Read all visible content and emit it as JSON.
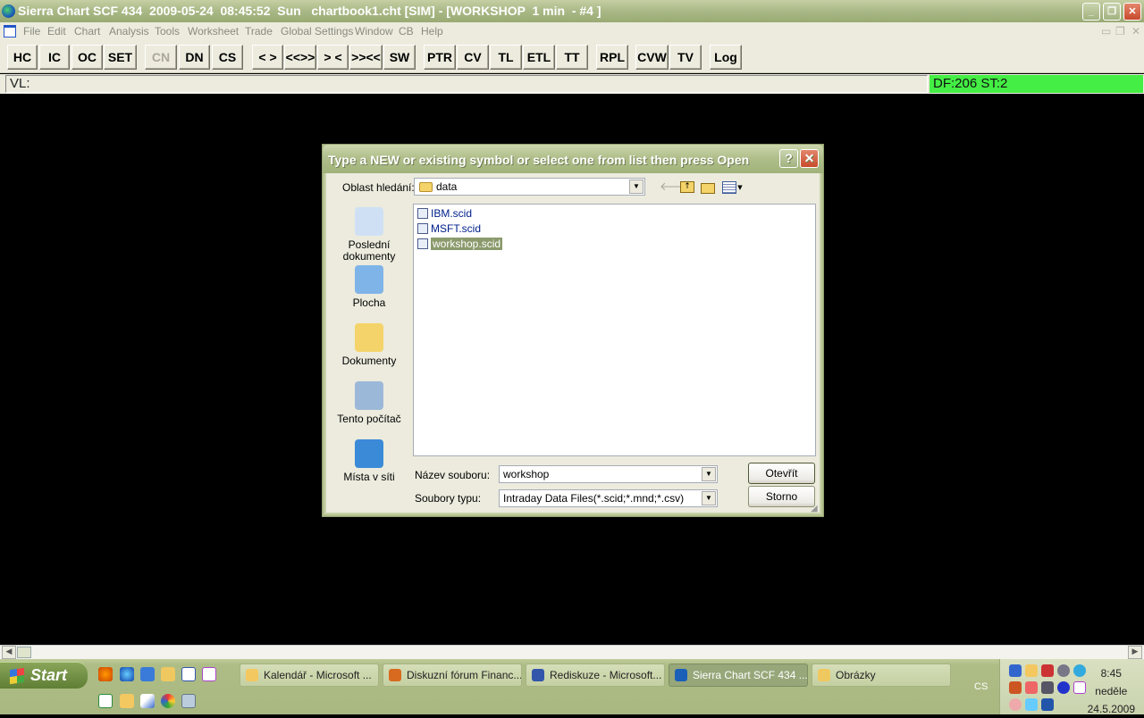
{
  "window": {
    "title": "Sierra Chart SCF 434  2009-05-24  08:45:52  Sun   chartbook1.cht [SIM] - [WORKSHOP  1 min  - #4 ]",
    "minimize": "_",
    "restore": "❐",
    "close": "✕"
  },
  "menu": {
    "items": [
      "File",
      "Edit",
      "Chart",
      "Analysis",
      "Tools",
      "Worksheet",
      "Trade",
      "Global Settings",
      "Window",
      "CB",
      "Help"
    ]
  },
  "toolbar": {
    "buttons": [
      {
        "label": "HC",
        "disabled": false
      },
      {
        "label": "IC",
        "disabled": false
      },
      {
        "label": "OC",
        "disabled": false
      },
      {
        "label": "SET",
        "disabled": false
      },
      {
        "label": "CN",
        "disabled": true
      },
      {
        "label": "DN",
        "disabled": false
      },
      {
        "label": "CS",
        "disabled": false
      },
      {
        "label": "< >",
        "disabled": false
      },
      {
        "label": "<<>>",
        "disabled": false
      },
      {
        "label": "> <",
        "disabled": false
      },
      {
        "label": ">><<",
        "disabled": false
      },
      {
        "label": "SW",
        "disabled": false
      },
      {
        "label": "PTR",
        "disabled": false
      },
      {
        "label": "CV",
        "disabled": false
      },
      {
        "label": "TL",
        "disabled": false
      },
      {
        "label": "ETL",
        "disabled": false
      },
      {
        "label": "TT",
        "disabled": false
      },
      {
        "label": "RPL",
        "disabled": false
      },
      {
        "label": "CVW",
        "disabled": false
      },
      {
        "label": "TV",
        "disabled": false
      },
      {
        "label": "Log",
        "disabled": false
      }
    ]
  },
  "status": {
    "values_line": "VL:",
    "df_status": "DF:206  ST:2",
    "df_color": "#44ee44"
  },
  "dialog": {
    "title": "Type a NEW or existing symbol or select one from list then press Open",
    "help": "?",
    "close": "✕",
    "look_in_label": "Oblast hledání:",
    "look_in_value": "data",
    "places": [
      {
        "label": "Poslední dokumenty",
        "icon": "recent-documents-icon"
      },
      {
        "label": "Plocha",
        "icon": "desktop-icon"
      },
      {
        "label": "Dokumenty",
        "icon": "documents-icon"
      },
      {
        "label": "Tento počítač",
        "icon": "my-computer-icon"
      },
      {
        "label": "Místa v síti",
        "icon": "network-places-icon"
      }
    ],
    "files": [
      {
        "name": "IBM.scid",
        "selected": false
      },
      {
        "name": "MSFT.scid",
        "selected": false
      },
      {
        "name": "workshop.scid",
        "selected": true
      }
    ],
    "filename_label": "Název souboru:",
    "filename_value": "workshop",
    "filetype_label": "Soubory typu:",
    "filetype_value": "Intraday Data Files(*.scid;*.mnd;*.csv)",
    "open_button": "Otevřít",
    "cancel_button": "Storno"
  },
  "taskbar": {
    "start": "Start",
    "tasks": [
      {
        "label": "Kalendář - Microsoft ...",
        "active": false
      },
      {
        "label": "Diskuzní fórum Financ...",
        "active": false
      },
      {
        "label": "Rediskuze - Microsoft...",
        "active": false
      },
      {
        "label": "Sierra Chart SCF 434 ...",
        "active": true
      },
      {
        "label": "Obrázky",
        "active": false
      }
    ],
    "language": "CS",
    "clock": {
      "time": "8:45",
      "day": "neděle",
      "date": "24.5.2009"
    }
  }
}
